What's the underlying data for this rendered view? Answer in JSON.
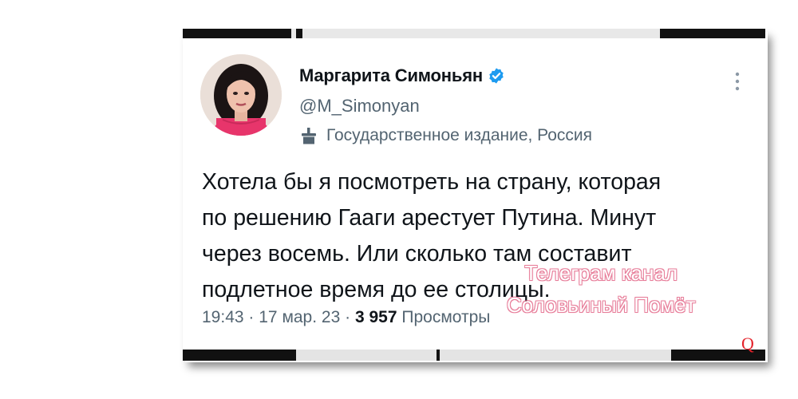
{
  "tweet": {
    "author_name": "Маргарита Симоньян",
    "handle": "@M_Simonyan",
    "label": "Государственное издание, Россия",
    "text_lines": [
      "Хотела бы я посмотреть на страну, которая",
      "по решению Гааги арестует Путина. Минут",
      "через восемь. Или сколько там составит",
      "подлетное время до ее столицы."
    ],
    "time": "19:43",
    "date": "17 мар. 23",
    "views_count": "3 957",
    "views_label": "Просмотры",
    "separator": "·"
  },
  "watermark": {
    "line1": "Телеграм канал",
    "line2": "Соловьиный Помёт"
  },
  "corner_logo": "Q",
  "colors": {
    "verified_blue": "#1d9bf0",
    "secondary_text": "#536471",
    "primary_text": "#0f1419",
    "watermark_pink": "#e0557a",
    "corner_logo_red": "#e4232b"
  },
  "icons": {
    "verified": "verified-badge-icon",
    "label": "state-media-podium-icon",
    "more": "more-vertical-icon"
  }
}
